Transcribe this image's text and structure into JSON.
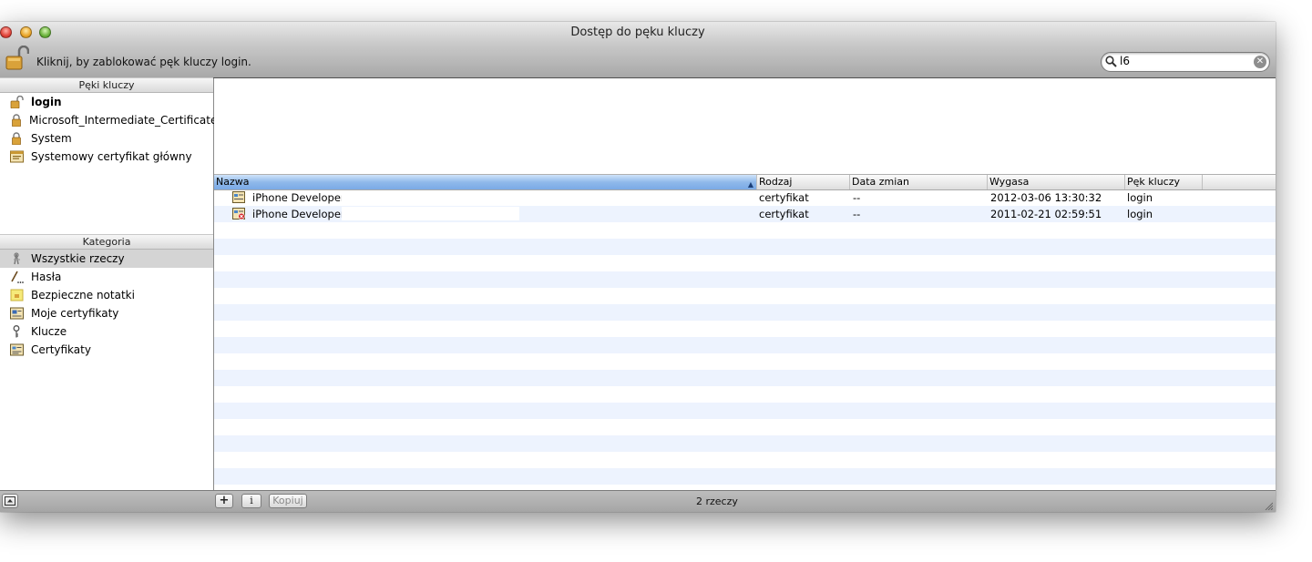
{
  "window": {
    "title": "Dostęp do pęku kluczy"
  },
  "toolbar": {
    "lock_label": "Kliknij, by zablokować pęk kluczy login.",
    "search_value": "l6"
  },
  "sidebar": {
    "keychains_header": "Pęki kluczy",
    "keychains": [
      {
        "label": "login",
        "icon": "unlocked-padlock-icon",
        "bold": true
      },
      {
        "label": "Microsoft_Intermediate_Certificates",
        "icon": "padlock-icon"
      },
      {
        "label": "System",
        "icon": "padlock-icon"
      },
      {
        "label": "Systemowy certyfikat główny",
        "icon": "root-cert-icon"
      }
    ],
    "category_header": "Kategoria",
    "categories": [
      {
        "label": "Wszystkie rzeczy",
        "icon": "all-items-icon",
        "selected": true
      },
      {
        "label": "Hasła",
        "icon": "password-pen-icon"
      },
      {
        "label": "Bezpieczne notatki",
        "icon": "secure-note-icon"
      },
      {
        "label": "Moje certyfikaty",
        "icon": "my-certificate-icon"
      },
      {
        "label": "Klucze",
        "icon": "key-icon"
      },
      {
        "label": "Certyfikaty",
        "icon": "certificate-icon"
      }
    ]
  },
  "table": {
    "columns": [
      "Nazwa",
      "Rodzaj",
      "Data zmian",
      "Wygasa",
      "Pęk kluczy"
    ],
    "sorted_column": "Nazwa",
    "rows": [
      {
        "name": "iPhone Developer",
        "kind": "certyfikat",
        "modified": "--",
        "expires": "2012-03-06 13:30:32",
        "keychain": "login",
        "status": "valid"
      },
      {
        "name": "iPhone Developer",
        "kind": "certyfikat",
        "modified": "--",
        "expires": "2011-02-21 02:59:51",
        "keychain": "login",
        "status": "expired"
      }
    ]
  },
  "bottombar": {
    "add_label": "+",
    "info_label": "i",
    "copy_label": "Kopiuj",
    "item_count": "2 rzeczy"
  },
  "colors": {
    "selection": "#d4d4d4",
    "stripe": "#edf3fe",
    "sorted_header": "#8fb9ea"
  }
}
